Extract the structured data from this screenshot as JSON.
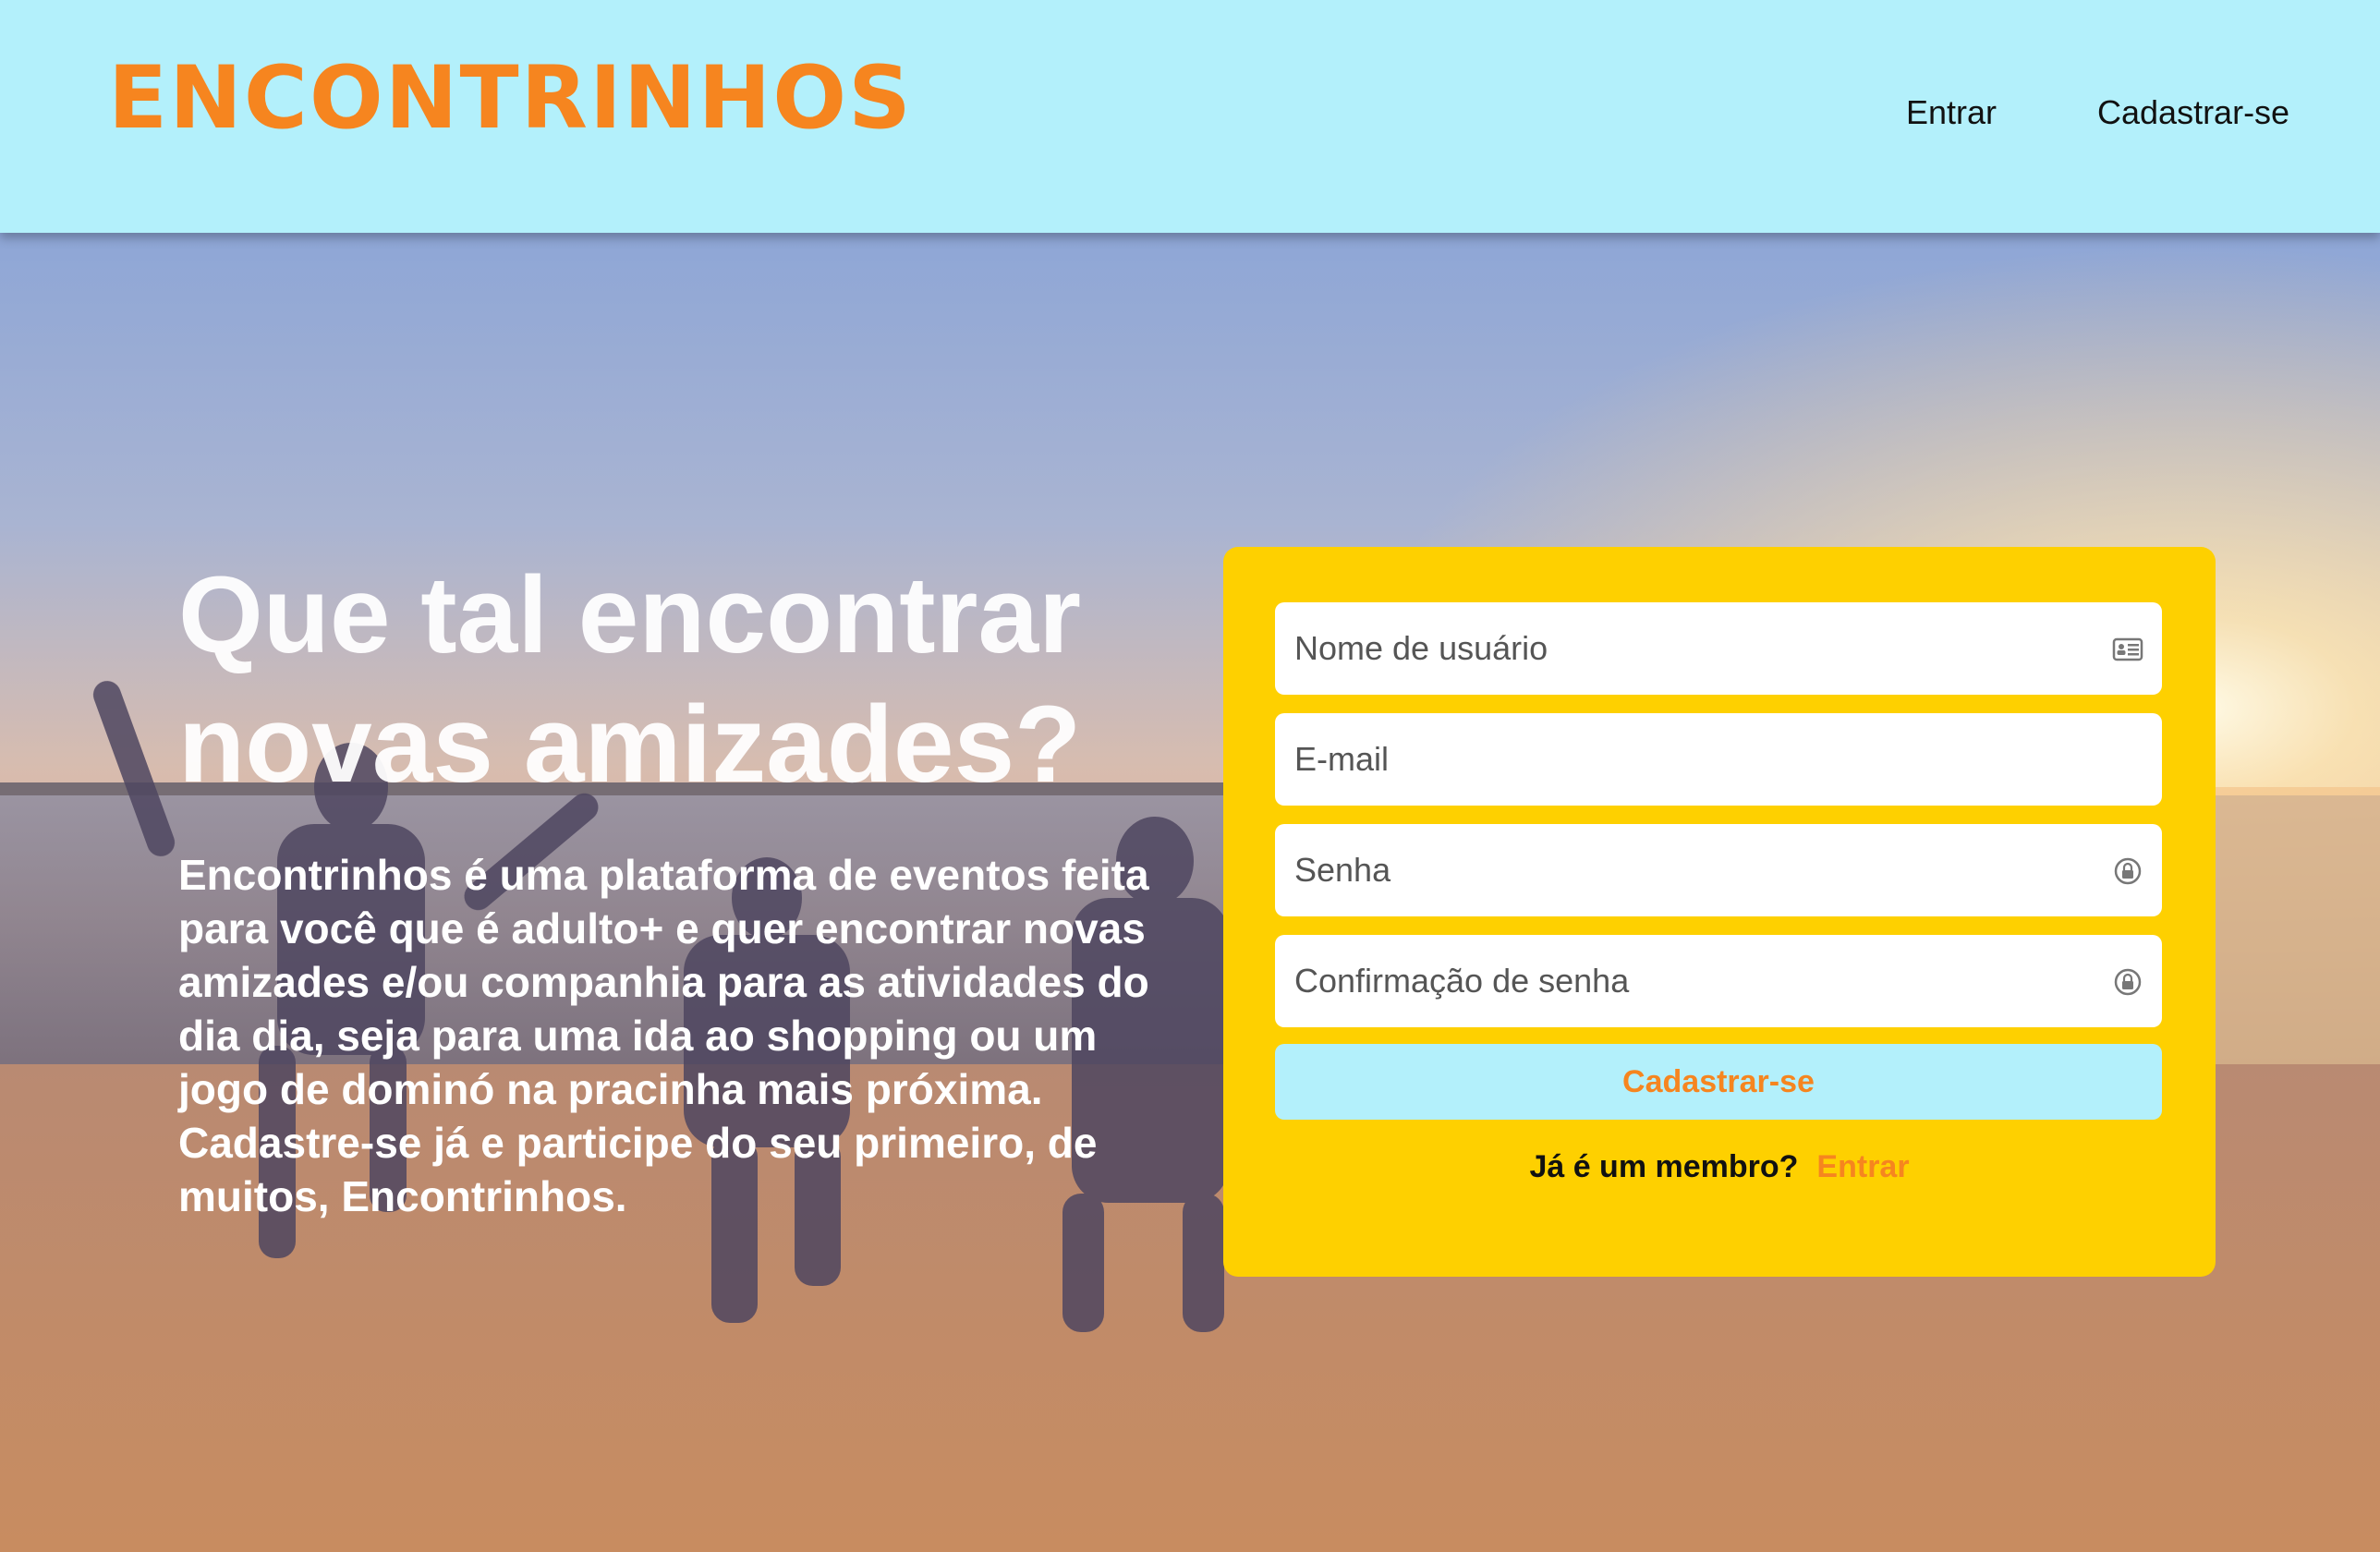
{
  "header": {
    "logo": "ENCONTRINHOS",
    "nav": {
      "login": "Entrar",
      "signup": "Cadastrar-se"
    }
  },
  "hero": {
    "headline": "Que tal encontrar novas amizades?",
    "description": "Encontrinhos é uma plataforma de eventos feita para você que é adulto+ e quer encontrar novas amizades e/ou companhia para as atividades do dia dia, seja para uma ida ao shopping ou um jogo de dominó na pracinha mais próxima. Cadastre-se já e participe do seu primeiro, de muitos, Encontrinhos."
  },
  "form": {
    "username_placeholder": "Nome de usuário",
    "email_placeholder": "E-mail",
    "password_placeholder": "Senha",
    "confirm_password_placeholder": "Confirmação de senha",
    "submit_label": "Cadastrar-se",
    "member_question": "Já é um membro?",
    "member_login_link": "Entrar"
  },
  "icons": {
    "username": "id-card-icon",
    "password": "lock-icon",
    "confirm_password": "lock-icon"
  },
  "colors": {
    "header_bg": "#b3f0fb",
    "brand_orange": "#f6851f",
    "card_yellow": "#fed000",
    "button_bg": "#b3f0fb"
  }
}
